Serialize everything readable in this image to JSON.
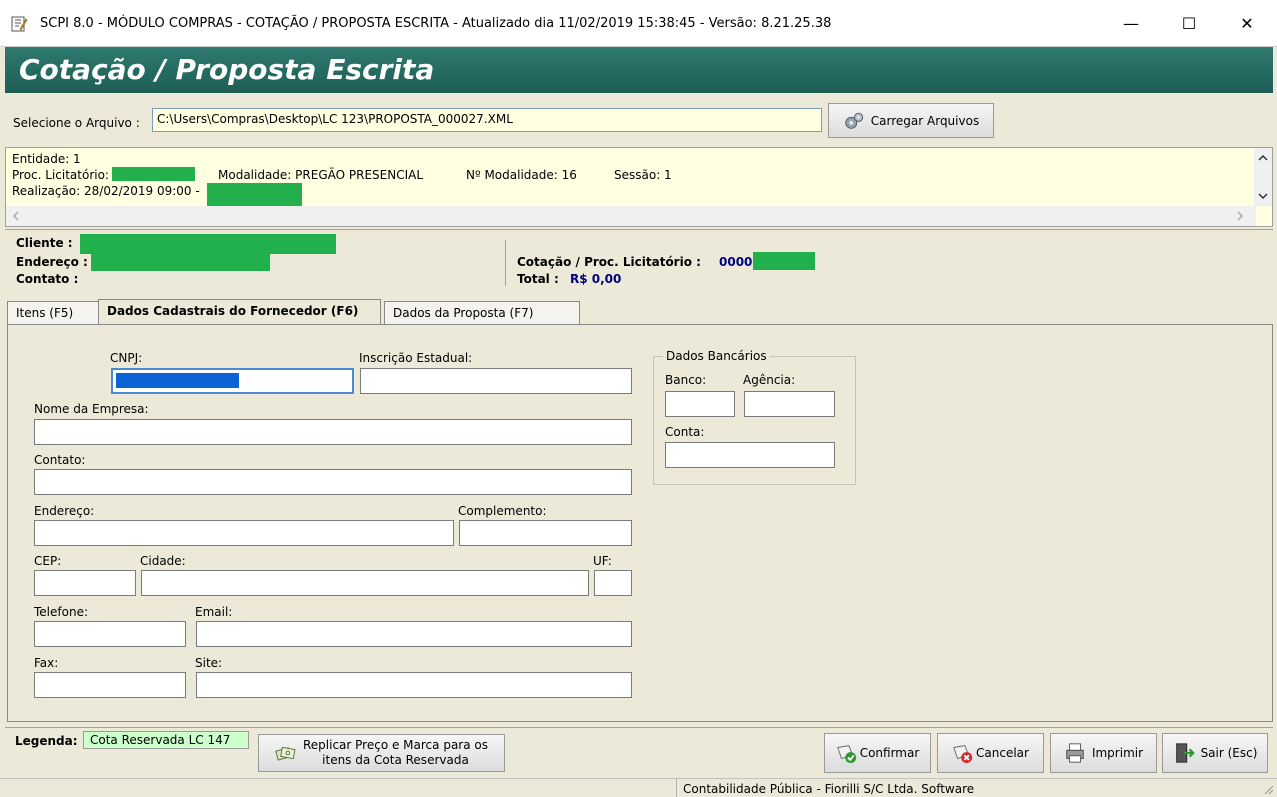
{
  "window": {
    "title": "SCPI 8.0 - MÓDULO COMPRAS - COTAÇÃO / PROPOSTA ESCRITA - Atualizado dia 11/02/2019 15:38:45 - Versão: 8.21.25.38",
    "minimize": "—",
    "maximize": "☐",
    "close": "✕"
  },
  "banner": {
    "title": "Cotação / Proposta Escrita"
  },
  "file": {
    "label": "Selecione o Arquivo :",
    "path": "C:\\Users\\Compras\\Desktop\\LC 123\\PROPOSTA_000027.XML",
    "load_button": "Carregar Arquivos"
  },
  "info": {
    "entidade": "Entidade: 1",
    "proc": "Proc. Licitatório:",
    "modalidade": "Modalidade: PREGÃO PRESENCIAL",
    "n_modalidade": "Nº Modalidade: 16",
    "sessao": "Sessão: 1",
    "realizacao": "Realização: 28/02/2019 09:00 -"
  },
  "client": {
    "cliente": "Cliente :",
    "endereco": "Endereço :",
    "contato": "Contato :",
    "cotacao_label": "Cotação / Proc. Licitatório :",
    "cotacao_value": "0000",
    "total_label": "Total :",
    "total_value": "R$ 0,00"
  },
  "tabs": [
    {
      "label": "Itens (F5)"
    },
    {
      "label": "Dados Cadastrais do Fornecedor (F6)"
    },
    {
      "label": "Dados da Proposta (F7)"
    }
  ],
  "form": {
    "cnpj": "CNPJ:",
    "ie": "Inscrição Estadual:",
    "empresa": "Nome da Empresa:",
    "contato": "Contato:",
    "endereco": "Endereço:",
    "complemento": "Complemento:",
    "cep": "CEP:",
    "cidade": "Cidade:",
    "uf": "UF:",
    "telefone": "Telefone:",
    "email": "Email:",
    "fax": "Fax:",
    "site": "Site:"
  },
  "bank": {
    "title": "Dados Bancários",
    "banco": "Banco:",
    "agencia": "Agência:",
    "conta": "Conta:"
  },
  "bottom": {
    "legenda": "Legenda:",
    "cota": "Cota Reservada LC 147",
    "replicar_1": "Replicar Preço e Marca para os",
    "replicar_2": "itens da Cota Reservada",
    "confirmar": "Confirmar",
    "cancelar": "Cancelar",
    "imprimir": "Imprimir",
    "sair": "Sair (Esc)"
  },
  "status": {
    "text": "Contabilidade Pública - Fiorilli S/C Ltda. Software"
  },
  "colors": {
    "banner": "#2f7a70",
    "redaction": "#21b04b",
    "selection": "#0a64d6",
    "legend_bg": "#ccffcc"
  }
}
